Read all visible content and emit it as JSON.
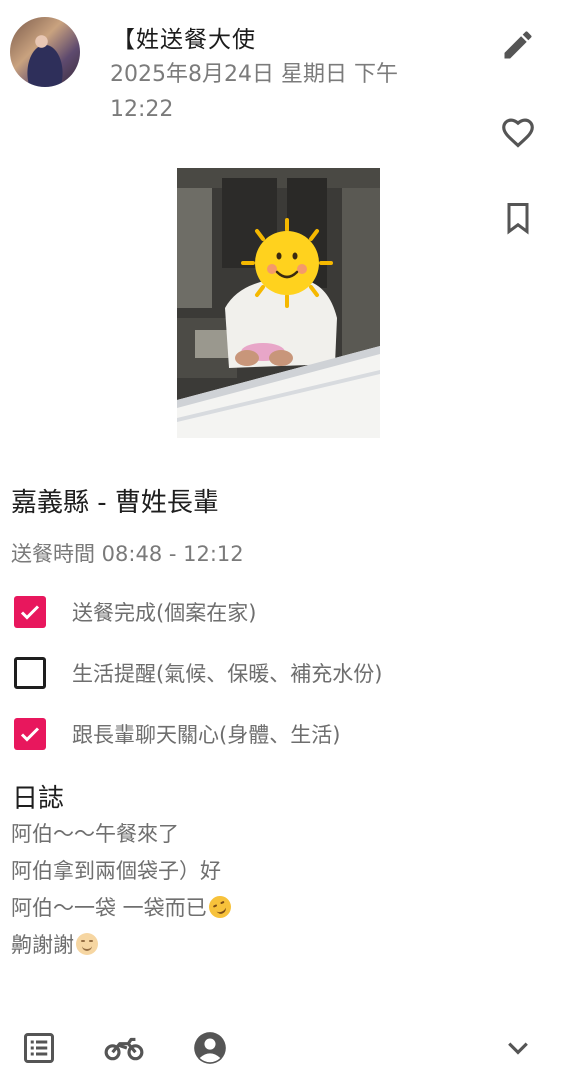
{
  "post": {
    "author": "【姓送餐大使",
    "datetime": "2025年8月24日 星期日 下午 12:22"
  },
  "actions": [
    "edit-icon",
    "heart-icon",
    "bookmark-icon"
  ],
  "visit": {
    "title": "嘉義縣 - 曹姓長輩",
    "time": "送餐時間 08:48 - 12:12"
  },
  "tasks": [
    {
      "label": "送餐完成(個案在家)",
      "checked": true
    },
    {
      "label": "生活提醒(氣候、保暖、補充水份)",
      "checked": false
    },
    {
      "label": "跟長輩聊天關心(身體、生活)",
      "checked": true
    }
  ],
  "log": {
    "heading": "日誌",
    "lines": [
      "阿伯～～午餐來了",
      "阿伯拿到兩個袋子）好",
      "阿伯～一袋 一袋而已",
      "齁謝謝"
    ],
    "emojis": [
      "rofl-emoji",
      "smiling-emoji"
    ]
  },
  "colors": {
    "accent": "#e8175d",
    "icon": "#555555"
  },
  "bottom_nav": [
    "list-icon",
    "motorcycle-icon",
    "account-icon",
    "chevron-down-icon"
  ]
}
